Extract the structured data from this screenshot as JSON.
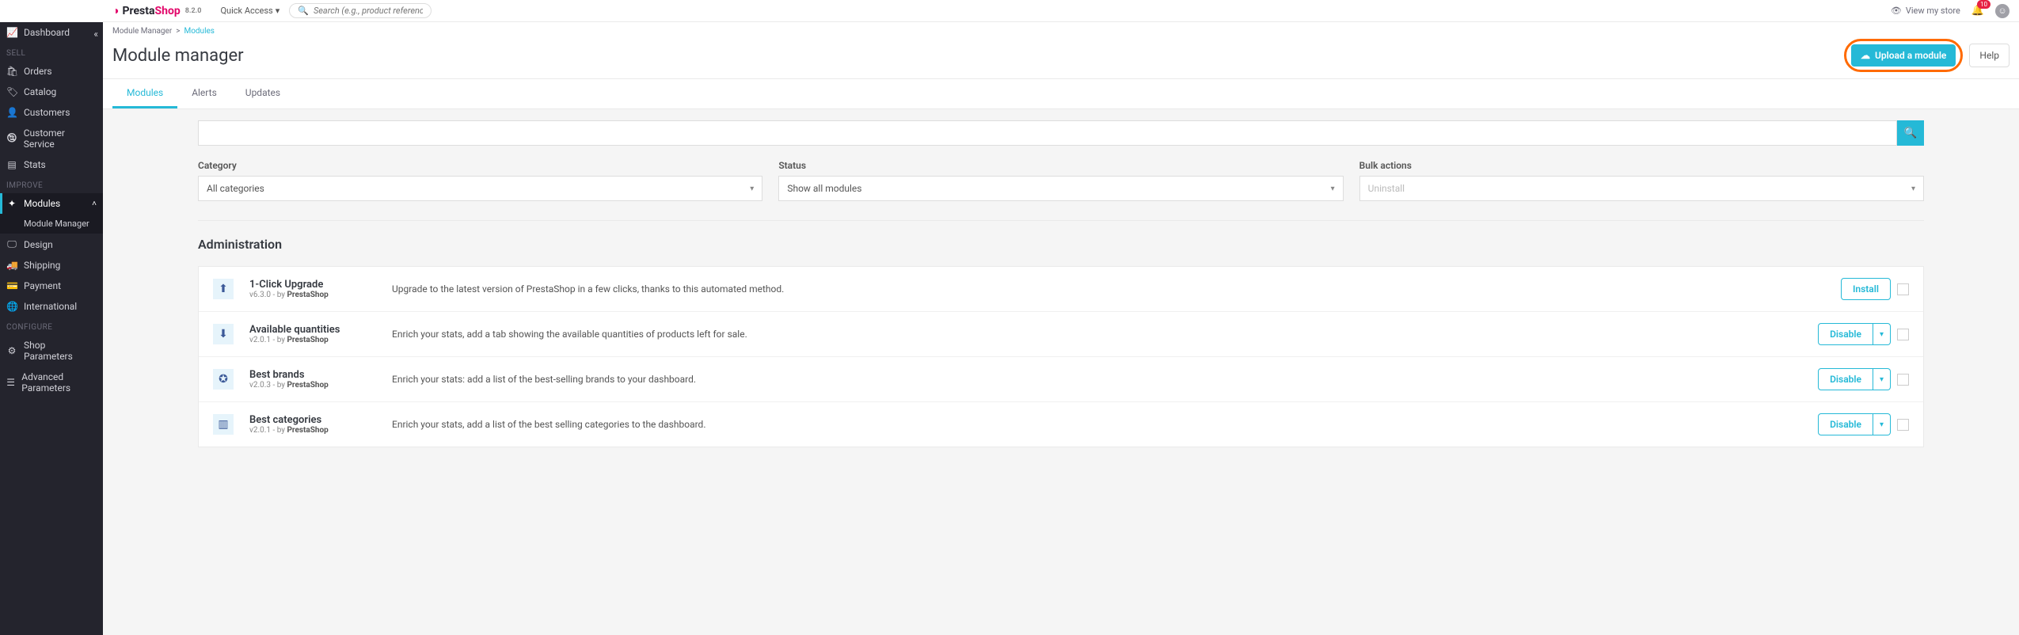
{
  "logo": {
    "part1": "Presta",
    "part2": "Shop",
    "version": "8.2.0"
  },
  "topbar": {
    "quick_access": "Quick Access",
    "search_placeholder": "Search (e.g., product reference, custon",
    "view_store": "View my store",
    "notif_count": "10"
  },
  "sidebar": {
    "dashboard": "Dashboard",
    "sell": "SELL",
    "orders": "Orders",
    "catalog": "Catalog",
    "customers": "Customers",
    "customer_service": "Customer Service",
    "stats": "Stats",
    "improve": "IMPROVE",
    "modules": "Modules",
    "module_manager": "Module Manager",
    "design": "Design",
    "shipping": "Shipping",
    "payment": "Payment",
    "international": "International",
    "configure": "CONFIGURE",
    "shop_params": "Shop Parameters",
    "adv_params": "Advanced Parameters"
  },
  "breadcrumb": {
    "a": "Module Manager",
    "sep": ">",
    "b": "Modules"
  },
  "page_title": "Module manager",
  "actions": {
    "upload": "Upload a module",
    "help": "Help"
  },
  "tabs": {
    "modules": "Modules",
    "alerts": "Alerts",
    "updates": "Updates"
  },
  "filters": {
    "category_label": "Category",
    "category_value": "All categories",
    "status_label": "Status",
    "status_value": "Show all modules",
    "bulk_label": "Bulk actions",
    "bulk_value": "Uninstall"
  },
  "section_title": "Administration",
  "buttons": {
    "install": "Install",
    "disable": "Disable"
  },
  "modules": [
    {
      "name": "1-Click Upgrade",
      "ver": "v6.3.0 - by ",
      "author": "PrestaShop",
      "desc": "Upgrade to the latest version of PrestaShop in a few clicks, thanks to this automated method.",
      "action": "install",
      "dropdown": false
    },
    {
      "name": "Available quantities",
      "ver": "v2.0.1 - by ",
      "author": "PrestaShop",
      "desc": "Enrich your stats, add a tab showing the available quantities of products left for sale.",
      "action": "disable",
      "dropdown": true
    },
    {
      "name": "Best brands",
      "ver": "v2.0.3 - by ",
      "author": "PrestaShop",
      "desc": "Enrich your stats: add a list of the best-selling brands to your dashboard.",
      "action": "disable",
      "dropdown": true
    },
    {
      "name": "Best categories",
      "ver": "v2.0.1 - by ",
      "author": "PrestaShop",
      "desc": "Enrich your stats, add a list of the best selling categories to the dashboard.",
      "action": "disable",
      "dropdown": true
    }
  ]
}
